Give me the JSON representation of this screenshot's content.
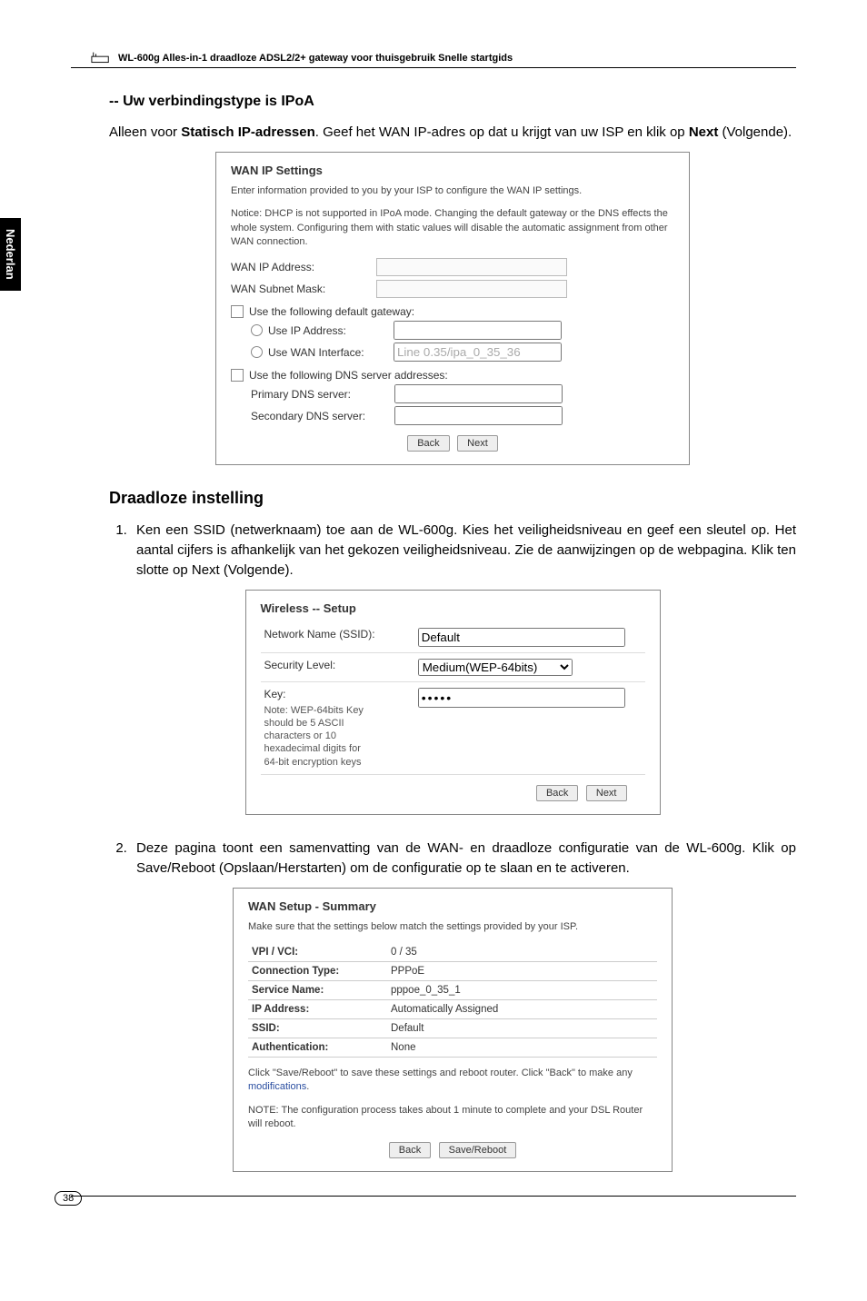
{
  "header": {
    "title": "WL-600g Alles-in-1 draadloze ADSL2/2+ gateway voor thuisgebruik Snelle startgids"
  },
  "side_tab": "Nederlan",
  "ipoa": {
    "heading": "-- Uw verbindingstype is IPoA",
    "para_pre": "Alleen voor ",
    "para_bold": "Statisch IP-adressen",
    "para_post": ". Geef het WAN IP-adres op dat u krijgt van uw ISP en klik op ",
    "para_bold2": "Next",
    "para_post2": " (Volgende)."
  },
  "shot1": {
    "title": "WAN IP Settings",
    "desc1": "Enter information provided to you by your ISP to configure the WAN IP settings.",
    "desc2": "Notice: DHCP is not supported in IPoA mode. Changing the default gateway or the DNS effects the whole system. Configuring them with static values will disable the automatic assignment from other WAN connection.",
    "wan_ip_label": "WAN IP Address:",
    "wan_subnet_label": "WAN Subnet Mask:",
    "gw_cb": "Use the following default gateway:",
    "gw_useip": "Use IP Address:",
    "gw_useif": "Use WAN Interface:",
    "gw_useif_val": "Line 0.35/ipa_0_35_36",
    "dns_cb": "Use the following DNS server addresses:",
    "dns_primary": "Primary DNS server:",
    "dns_secondary": "Secondary DNS server:",
    "btn_back": "Back",
    "btn_next": "Next"
  },
  "wireless_section": {
    "heading": "Draadloze instelling",
    "item1_pre": "Ken een ",
    "item1_b1": "SSID",
    "item1_mid": " (netwerknaam) toe aan de WL-600g. Kies het veiligheidsniveau en geef een sleutel op. Het aantal cijfers is afhankelijk van het gekozen veiligheidsniveau. Zie de aanwijzingen op de webpagina. Klik ten slotte op ",
    "item1_b2": "Next",
    "item1_post": " (Volgende)."
  },
  "shot2": {
    "title": "Wireless -- Setup",
    "rows": {
      "ssid_label": "Network Name (SSID):",
      "ssid_value": "Default",
      "sec_label": "Security Level:",
      "sec_value": "Medium(WEP-64bits)",
      "key_label": "Key:",
      "key_value": "•••••",
      "key_note": "Note: WEP-64bits Key should be 5 ASCII characters or 10 hexadecimal digits for 64-bit encryption keys"
    },
    "btn_back": "Back",
    "btn_next": "Next"
  },
  "item2": {
    "pre": "Deze pagina toont een samenvatting van de WAN- en draadloze configuratie van de WL-600g. Klik op ",
    "bold": "Save/Reboot",
    "post": " (Opslaan/Herstarten) om de configuratie op te slaan en te activeren."
  },
  "shot3": {
    "title": "WAN Setup - Summary",
    "desc": "Make sure that the settings below match the settings provided by your ISP.",
    "rows": [
      {
        "k": "VPI / VCI:",
        "v": "0 / 35"
      },
      {
        "k": "Connection Type:",
        "v": "PPPoE"
      },
      {
        "k": "Service Name:",
        "v": "pppoe_0_35_1"
      },
      {
        "k": "IP Address:",
        "v": "Automatically Assigned"
      },
      {
        "k": "SSID:",
        "v": "Default"
      },
      {
        "k": "Authentication:",
        "v": "None"
      }
    ],
    "note1_pre": "Click \"Save/Reboot\" to save these settings and reboot router. Click \"Back\" to make any ",
    "note1_link": "modifications",
    "note1_post": ".",
    "note2": "NOTE: The configuration process takes about 1 minute to complete and your DSL Router will reboot.",
    "btn_back": "Back",
    "btn_save": "Save/Reboot"
  },
  "page_number": "38"
}
